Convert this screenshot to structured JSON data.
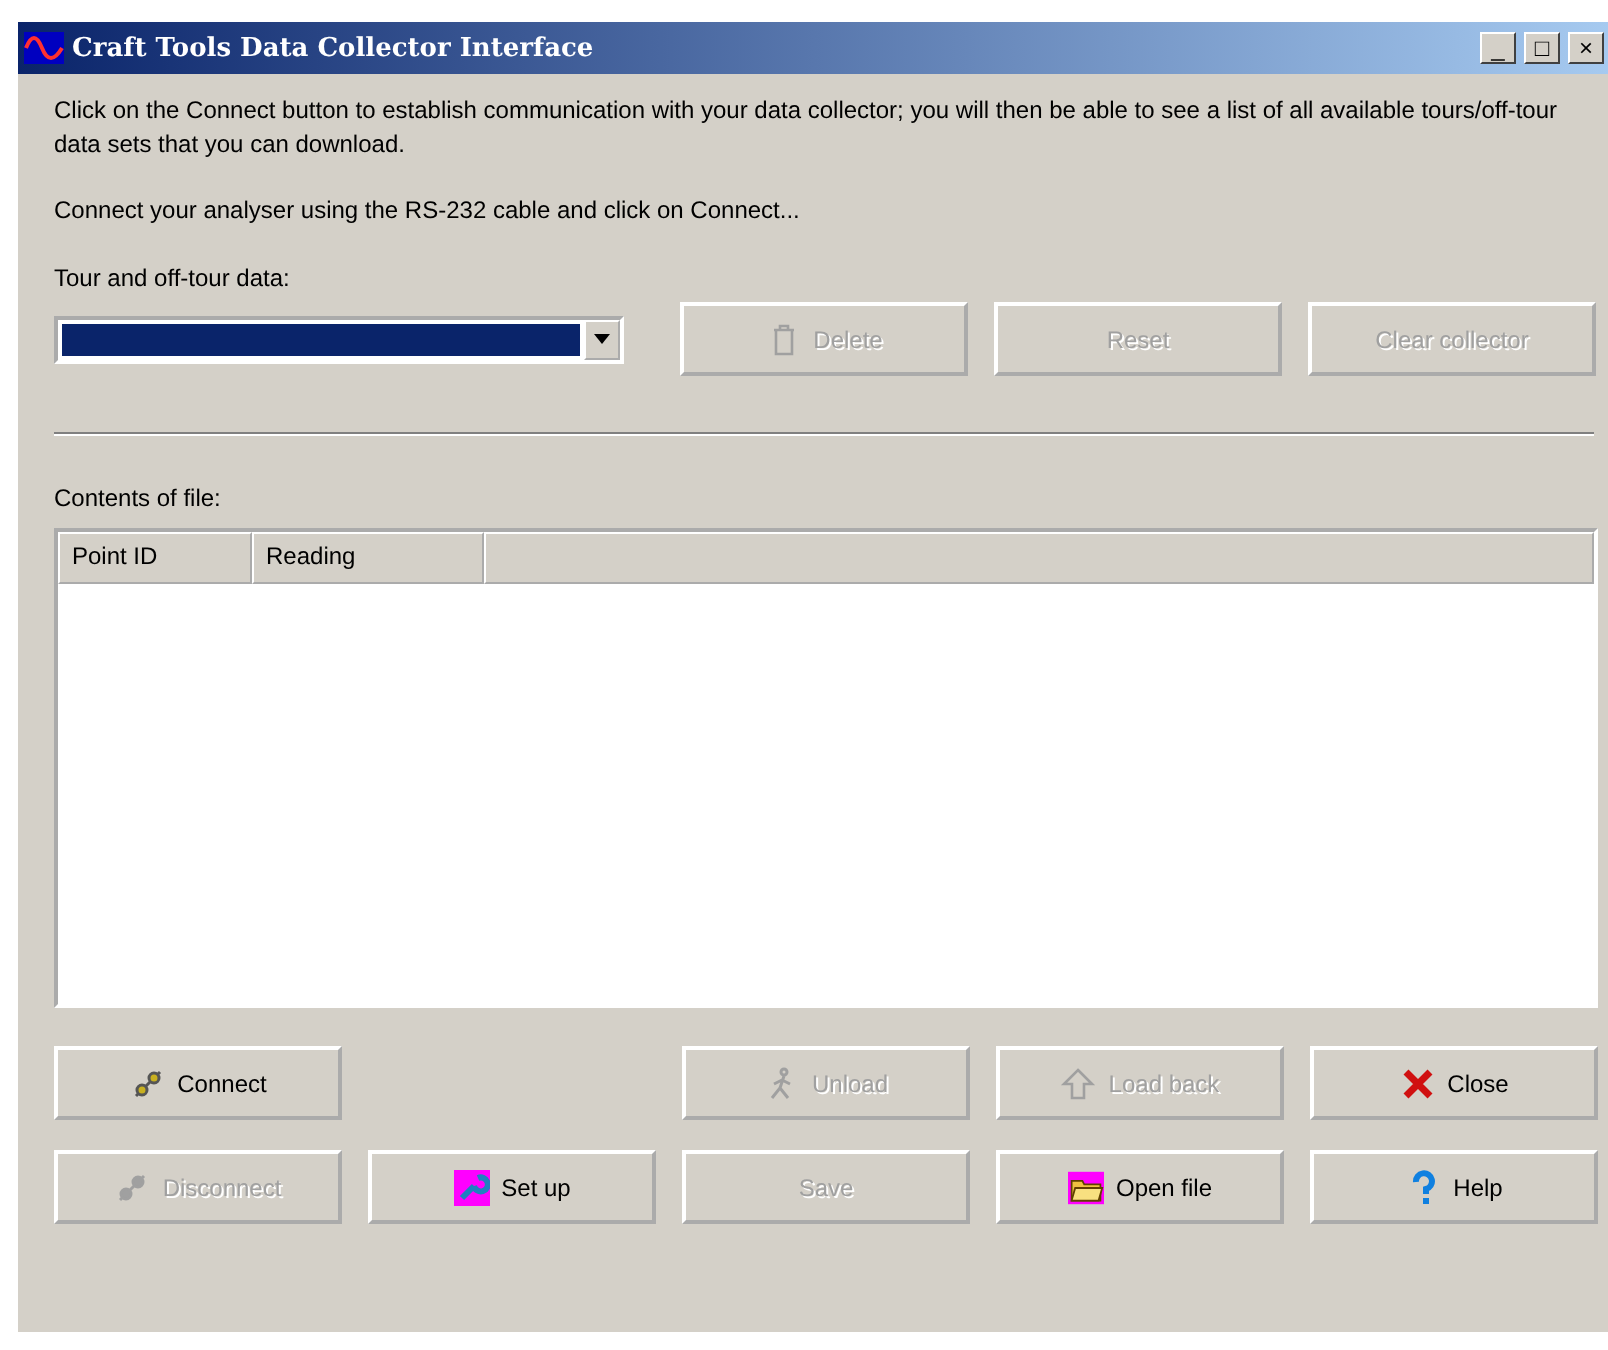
{
  "window": {
    "title": "Craft Tools Data Collector Interface",
    "controls": [
      "_",
      "□",
      "×"
    ]
  },
  "intro": "Click on the Connect button to establish communication with your data collector; you will then be able to see a list of all available tours/off-tour data sets that you can download.",
  "instruction": "Connect your analyser using the RS-232 cable and click on Connect...",
  "tour_field": {
    "label": "Tour and off-tour data:",
    "highlighted": true
  },
  "top_buttons": [
    {
      "label": "Delete",
      "disabled": true
    },
    {
      "label": "Reset",
      "disabled": true
    },
    {
      "label": "Clear collector",
      "disabled": true
    }
  ],
  "contents_label": "Contents of file:",
  "table": {
    "columns": [
      "Point ID",
      "Reading"
    ]
  },
  "buttons": [
    {
      "label": "Connect",
      "disabled": false
    },
    {
      "label": "Unload",
      "disabled": true
    },
    {
      "label": "Load back",
      "disabled": true
    },
    {
      "label": "Close",
      "disabled": false
    },
    {
      "label": "Disconnect",
      "disabled": true
    },
    {
      "label": "Set up",
      "disabled": false
    },
    {
      "label": "Save",
      "disabled": true
    },
    {
      "label": "Open file",
      "disabled": false
    },
    {
      "label": "Help",
      "disabled": false
    }
  ]
}
